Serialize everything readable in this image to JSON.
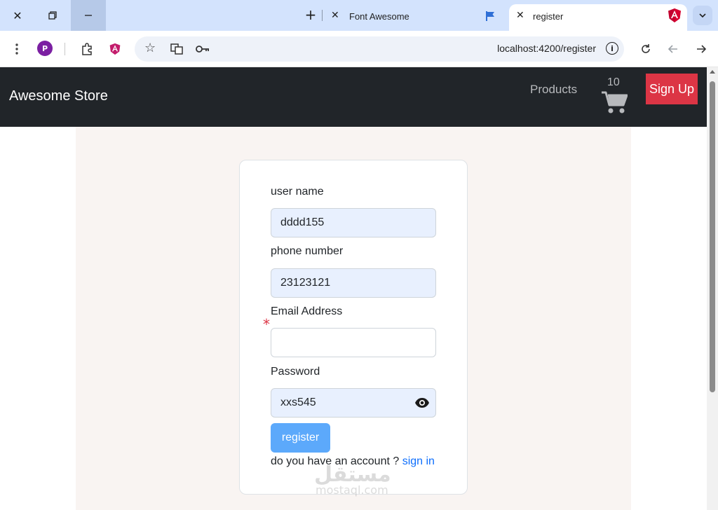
{
  "browser": {
    "tabs": [
      {
        "title": "Font Awesome",
        "active": false
      },
      {
        "title": "register",
        "active": true
      }
    ],
    "url": "localhost:4200/register",
    "profile_initial": "P"
  },
  "navbar": {
    "brand": "Awesome Store",
    "products_link": "Products",
    "cart_count": "10",
    "signup_button": "Sign Up"
  },
  "form": {
    "username": {
      "label": "user name",
      "value": "dddd155"
    },
    "phone": {
      "label": "phone number",
      "value": "23123121"
    },
    "email": {
      "label": "Email Address",
      "value": "",
      "required_marker": "*"
    },
    "password": {
      "label": "Password",
      "value": "xxs545"
    },
    "submit_label": "register",
    "account_prompt": "do you have an account ?",
    "signin_link": "sign in"
  },
  "watermark": {
    "arabic": "مستقل",
    "latin": "mostaql.com"
  },
  "colors": {
    "navbar_bg": "#212529",
    "signup_bg": "#dc3545",
    "register_bg": "#5ca9fb",
    "link": "#0d6efd",
    "autofill_bg": "#e8f0fe",
    "content_bg": "#f9f4f2"
  }
}
